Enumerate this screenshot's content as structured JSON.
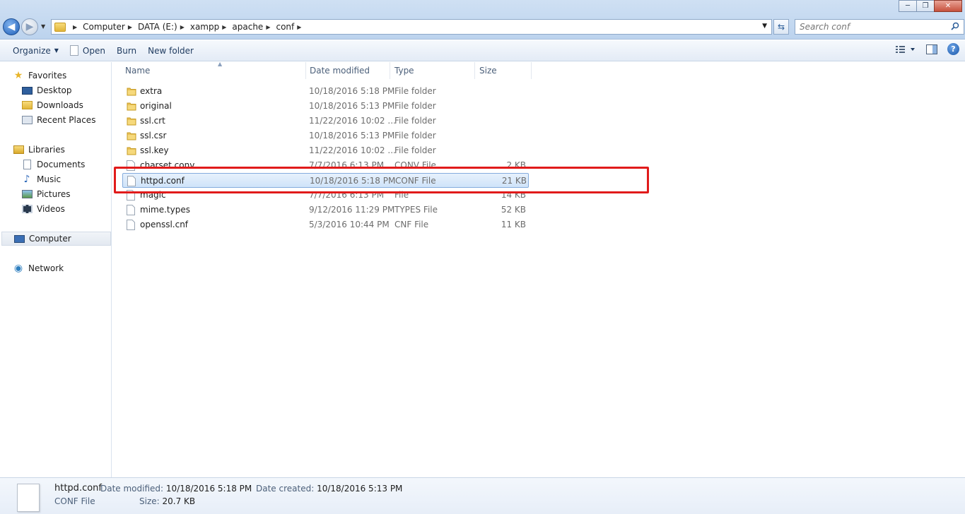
{
  "window": {
    "minimize": "─",
    "maximize": "❐",
    "close": "✕"
  },
  "address": {
    "crumbs": [
      "Computer",
      "DATA (E:)",
      "xampp",
      "apache",
      "conf"
    ]
  },
  "search": {
    "placeholder": "Search conf"
  },
  "toolbar": {
    "organize_label": "Organize",
    "open_label": "Open",
    "burn_label": "Burn",
    "new_folder_label": "New folder"
  },
  "navpane": {
    "favorites_label": "Favorites",
    "favorites": [
      "Desktop",
      "Downloads",
      "Recent Places"
    ],
    "libraries_label": "Libraries",
    "libraries": [
      "Documents",
      "Music",
      "Pictures",
      "Videos"
    ],
    "computer_label": "Computer",
    "network_label": "Network"
  },
  "columns": {
    "name": "Name",
    "date": "Date modified",
    "type": "Type",
    "size": "Size"
  },
  "files": [
    {
      "name": "extra",
      "date": "10/18/2016 5:18 PM",
      "type": "File folder",
      "size": "",
      "kind": "folder"
    },
    {
      "name": "original",
      "date": "10/18/2016 5:13 PM",
      "type": "File folder",
      "size": "",
      "kind": "folder"
    },
    {
      "name": "ssl.crt",
      "date": "11/22/2016 10:02 ...",
      "type": "File folder",
      "size": "",
      "kind": "folder"
    },
    {
      "name": "ssl.csr",
      "date": "10/18/2016 5:13 PM",
      "type": "File folder",
      "size": "",
      "kind": "folder"
    },
    {
      "name": "ssl.key",
      "date": "11/22/2016 10:02 ...",
      "type": "File folder",
      "size": "",
      "kind": "folder"
    },
    {
      "name": "charset.conv",
      "date": "7/7/2016 6:13 PM",
      "type": "CONV File",
      "size": "2 KB",
      "kind": "file"
    },
    {
      "name": "httpd.conf",
      "date": "10/18/2016 5:18 PM",
      "type": "CONF File",
      "size": "21 KB",
      "kind": "file",
      "selected": true
    },
    {
      "name": "magic",
      "date": "7/7/2016 6:13 PM",
      "type": "File",
      "size": "14 KB",
      "kind": "file"
    },
    {
      "name": "mime.types",
      "date": "9/12/2016 11:29 PM",
      "type": "TYPES File",
      "size": "52 KB",
      "kind": "file"
    },
    {
      "name": "openssl.cnf",
      "date": "5/3/2016 10:44 PM",
      "type": "CNF File",
      "size": "11 KB",
      "kind": "file"
    }
  ],
  "details": {
    "name": "httpd.conf",
    "type": "CONF File",
    "date_modified_label": "Date modified:",
    "date_modified": "10/18/2016 5:18 PM",
    "date_created_label": "Date created:",
    "date_created": "10/18/2016 5:13 PM",
    "size_label": "Size:",
    "size": "20.7 KB"
  },
  "colors": {
    "highlight": "#e11b1b",
    "selection": "#cfe3f9"
  }
}
